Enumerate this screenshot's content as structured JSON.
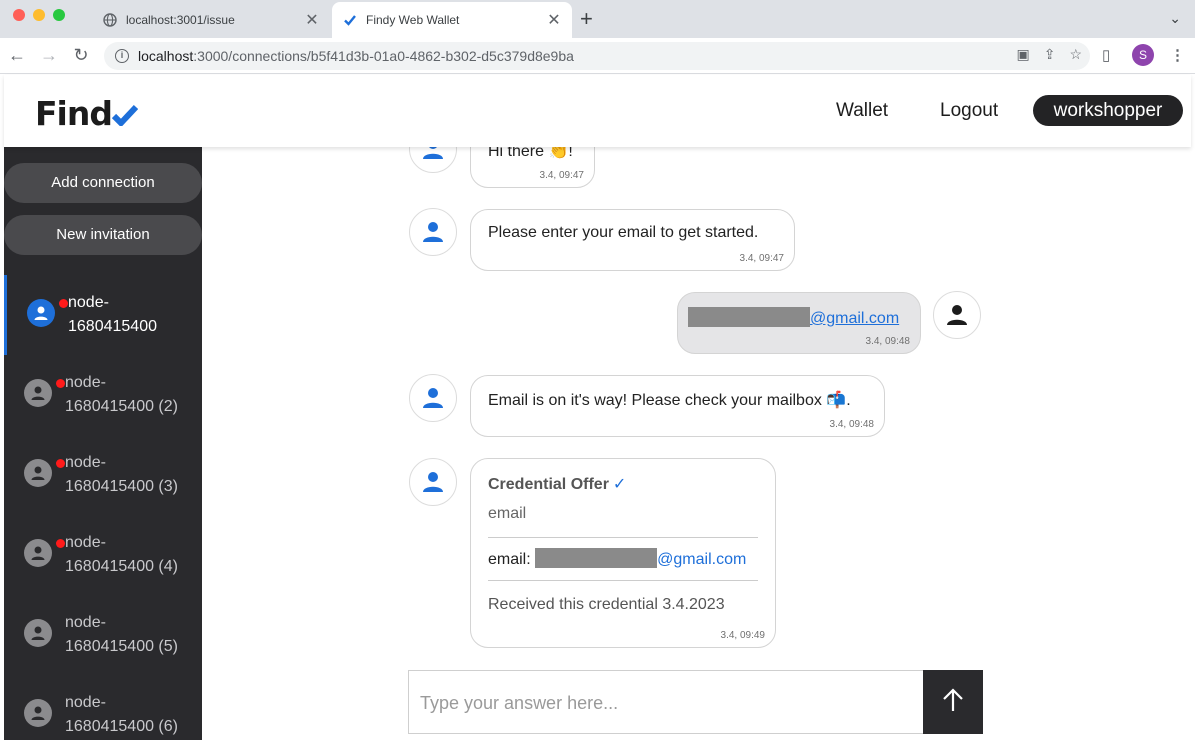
{
  "browser": {
    "tabs": [
      {
        "title": "localhost:3001/issue",
        "active": false
      },
      {
        "title": "Findy Web Wallet",
        "active": true
      }
    ],
    "url_host": "localhost",
    "url_rest": ":3000/connections/b5f41d3b-01a0-4862-b302-d5c379d8e9ba",
    "profile_initial": "S"
  },
  "header": {
    "logo_text": "Find",
    "nav": [
      "Wallet",
      "Logout"
    ],
    "user": "workshopper"
  },
  "sidebar": {
    "add_connection": "Add connection",
    "new_invitation": "New invitation",
    "connections": [
      {
        "line1": "node-",
        "line2": "1680415400",
        "active": true,
        "unread": true
      },
      {
        "line1": "node-",
        "line2": "1680415400 (2)",
        "active": false,
        "unread": true
      },
      {
        "line1": "node-",
        "line2": "1680415400 (3)",
        "active": false,
        "unread": true
      },
      {
        "line1": "node-",
        "line2": "1680415400 (4)",
        "active": false,
        "unread": true
      },
      {
        "line1": "node-",
        "line2": "1680415400 (5)",
        "active": false,
        "unread": false
      },
      {
        "line1": "node-",
        "line2": "1680415400 (6)",
        "active": false,
        "unread": false
      }
    ]
  },
  "chat": {
    "messages": [
      {
        "text": "Hi there 👏!",
        "time": "3.4, 09:47",
        "from": "them"
      },
      {
        "text": "Please enter your email to get started.",
        "time": "3.4, 09:47",
        "from": "them"
      },
      {
        "text": "@gmail.com",
        "time": "3.4, 09:48",
        "from": "me"
      },
      {
        "text": "Email is on it's way! Please check your mailbox 📬.",
        "time": "3.4, 09:48",
        "from": "them"
      }
    ],
    "credential": {
      "title": "Credential Offer",
      "type": "email",
      "attr_label": "email:",
      "attr_value_suffix": "@gmail.com",
      "received": "Received this credential 3.4.2023",
      "time": "3.4, 09:49"
    },
    "composer_placeholder": "Type your answer here..."
  },
  "colors": {
    "accent": "#1e6fd9",
    "sidebar_bg": "#2a2a2d",
    "unread_dot": "#ff1a1a"
  }
}
